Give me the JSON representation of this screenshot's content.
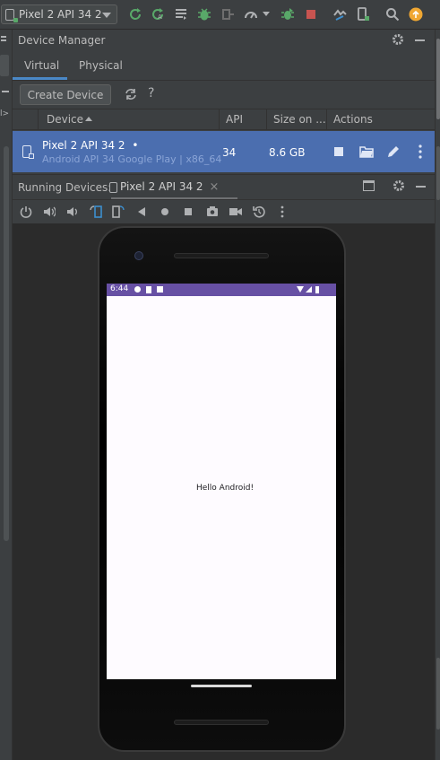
{
  "toolbar": {
    "device_selector": "Pixel 2 API 34 2",
    "colors": {
      "green": "#59a869",
      "red": "#c75450",
      "orange": "#f0a732",
      "icon": "#afb1b3"
    }
  },
  "device_manager": {
    "title": "Device Manager",
    "tabs": [
      {
        "label": "Virtual",
        "selected": true
      },
      {
        "label": "Physical",
        "selected": false
      }
    ],
    "create_device_label": "Create Device",
    "help_label": "?",
    "columns": {
      "device": "Device",
      "api": "API",
      "size": "Size on ...",
      "actions": "Actions"
    },
    "rows": [
      {
        "name": "Pixel 2 API 34 2",
        "running_dot": "•",
        "subtitle": "Android API 34 Google Play | x86_64",
        "api": "34",
        "size": "8.6 GB"
      }
    ]
  },
  "running_devices": {
    "label": "Running Devices:",
    "tab_label": "Pixel 2 API 34 2",
    "close_label": "×"
  },
  "emulator": {
    "clock": "6:44",
    "screen_text": "Hello Android!",
    "status_bar_color": "#6750a4"
  }
}
